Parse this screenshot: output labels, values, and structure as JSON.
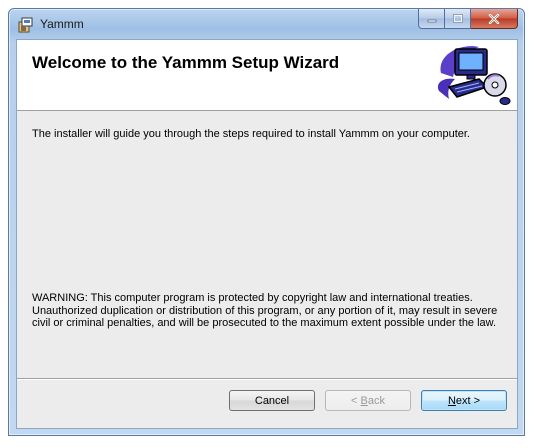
{
  "window": {
    "title": "Yammm"
  },
  "banner": {
    "title": "Welcome to the Yammm Setup Wizard"
  },
  "content": {
    "intro": "The installer will guide you through the steps required to install Yammm on your computer.",
    "warning": "WARNING: This computer program is protected by copyright law and international treaties. Unauthorized duplication or distribution of this program, or any portion of it, may result in severe civil or criminal penalties, and will be prosecuted to the maximum extent possible under the law."
  },
  "buttons": {
    "cancel": "Cancel",
    "back_prefix": "< ",
    "back_mnemonic": "B",
    "back_rest": "ack",
    "next_mnemonic": "N",
    "next_rest": "ext >"
  },
  "icons": {
    "app": "installer-box-icon",
    "banner": "computer-with-disc-icon",
    "minimize": "minimize-icon",
    "maximize": "maximize-icon",
    "close": "close-icon"
  },
  "colors": {
    "titlebar": "#9ebfe6",
    "client_bg": "#ececec",
    "banner_bg": "#ffffff",
    "close_red": "#c9473a"
  }
}
